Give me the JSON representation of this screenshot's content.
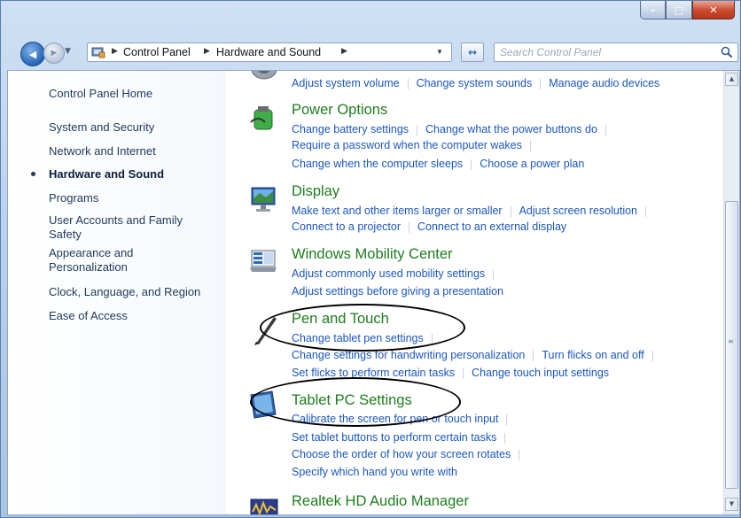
{
  "window": {
    "minimize_glyph": "–",
    "maximize_glyph": "□",
    "close_glyph": "✕"
  },
  "nav": {
    "back_glyph": "◀",
    "forward_glyph": "▶",
    "breadcrumb": [
      "Control Panel",
      "Hardware and Sound"
    ],
    "search_placeholder": "Search Control Panel"
  },
  "left_pane": {
    "home": "Control Panel Home",
    "items": [
      {
        "label": "System and Security"
      },
      {
        "label": "Network and Internet"
      },
      {
        "label": "Hardware and Sound",
        "active": true
      },
      {
        "label": "Programs"
      },
      {
        "label": "User Accounts and Family Safety"
      },
      {
        "label": "Appearance and Personalization"
      },
      {
        "label": "Clock, Language, and Region"
      },
      {
        "label": "Ease of Access"
      }
    ]
  },
  "main": {
    "top_links": [
      "Adjust system volume",
      "Change system sounds",
      "Manage audio devices"
    ],
    "categories": [
      {
        "title": "Power Options",
        "icon": "power-options-icon",
        "rows": [
          [
            "Change battery settings",
            "Change what the power buttons do"
          ],
          [
            "Require a password when the computer wakes"
          ],
          [
            "Change when the computer sleeps",
            "Choose a power plan"
          ]
        ]
      },
      {
        "title": "Display",
        "icon": "display-icon",
        "rows": [
          [
            "Make text and other items larger or smaller",
            "Adjust screen resolution"
          ],
          [
            "Connect to a projector",
            "Connect to an external display"
          ]
        ]
      },
      {
        "title": "Windows Mobility Center",
        "icon": "mobility-center-icon",
        "rows": [
          [
            "Adjust commonly used mobility settings"
          ],
          [
            "Adjust settings before giving a presentation"
          ]
        ]
      },
      {
        "title": "Pen and Touch",
        "icon": "pen-icon",
        "rows": [
          [
            "Change tablet pen settings"
          ],
          [
            "Change settings for handwriting personalization",
            "Turn flicks on and off"
          ],
          [
            "Set flicks to perform certain tasks",
            "Change touch input settings"
          ]
        ]
      },
      {
        "title": "Tablet PC Settings",
        "icon": "tablet-pc-icon",
        "rows": [
          [
            "Calibrate the screen for pen or touch input"
          ],
          [
            "Set tablet buttons to perform certain tasks"
          ],
          [
            "Choose the order of how your screen rotates"
          ],
          [
            "Specify which hand you write with"
          ]
        ]
      },
      {
        "title": "Realtek HD Audio Manager",
        "icon": "realtek-audio-icon",
        "rows": []
      }
    ]
  },
  "scrollbar": {
    "up_glyph": "▲",
    "down_glyph": "▼"
  },
  "colors": {
    "link": "#1a56c4",
    "category_title": "#1e7d1e",
    "left_pane_text": "#1e395b"
  }
}
